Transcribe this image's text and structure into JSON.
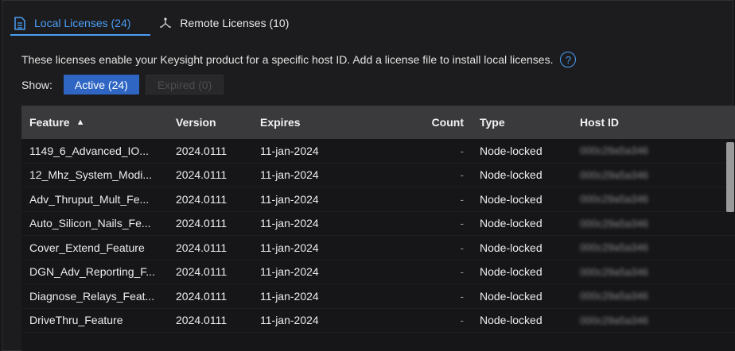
{
  "tabs": [
    {
      "label": "Local Licenses (24)",
      "icon": "document-icon",
      "active": true
    },
    {
      "label": "Remote Licenses (10)",
      "icon": "network-icon",
      "active": false
    }
  ],
  "description": "These licenses enable your Keysight product for a specific host ID. Add a license file to install local licenses.",
  "help_icon": "?",
  "filter": {
    "label": "Show:",
    "active": "Active (24)",
    "expired": "Expired (0)"
  },
  "table": {
    "headers": {
      "feature": "Feature",
      "sort_indicator": "▲",
      "version": "Version",
      "expires": "Expires",
      "count": "Count",
      "type": "Type",
      "hostid": "Host ID"
    },
    "rows": [
      {
        "feature": "1149_6_Advanced_IO...",
        "version": "2024.0111",
        "expires": "11-jan-2024",
        "count": "-",
        "type": "Node-locked",
        "hostid": "000c29a5a346"
      },
      {
        "feature": "12_Mhz_System_Modi...",
        "version": "2024.0111",
        "expires": "11-jan-2024",
        "count": "-",
        "type": "Node-locked",
        "hostid": "000c29a5a346"
      },
      {
        "feature": "Adv_Thruput_Mult_Fe...",
        "version": "2024.0111",
        "expires": "11-jan-2024",
        "count": "-",
        "type": "Node-locked",
        "hostid": "000c29a5a346"
      },
      {
        "feature": "Auto_Silicon_Nails_Fe...",
        "version": "2024.0111",
        "expires": "11-jan-2024",
        "count": "-",
        "type": "Node-locked",
        "hostid": "000c29a5a346"
      },
      {
        "feature": "Cover_Extend_Feature",
        "version": "2024.0111",
        "expires": "11-jan-2024",
        "count": "-",
        "type": "Node-locked",
        "hostid": "000c29a5a346"
      },
      {
        "feature": "DGN_Adv_Reporting_F...",
        "version": "2024.0111",
        "expires": "11-jan-2024",
        "count": "-",
        "type": "Node-locked",
        "hostid": "000c29a5a346"
      },
      {
        "feature": "Diagnose_Relays_Feat...",
        "version": "2024.0111",
        "expires": "11-jan-2024",
        "count": "-",
        "type": "Node-locked",
        "hostid": "000c29a5a346"
      },
      {
        "feature": "DriveThru_Feature",
        "version": "2024.0111",
        "expires": "11-jan-2024",
        "count": "-",
        "type": "Node-locked",
        "hostid": "000c29a5a346"
      }
    ]
  },
  "colors": {
    "accent": "#4a9ef5",
    "active_button": "#2f66c4"
  }
}
